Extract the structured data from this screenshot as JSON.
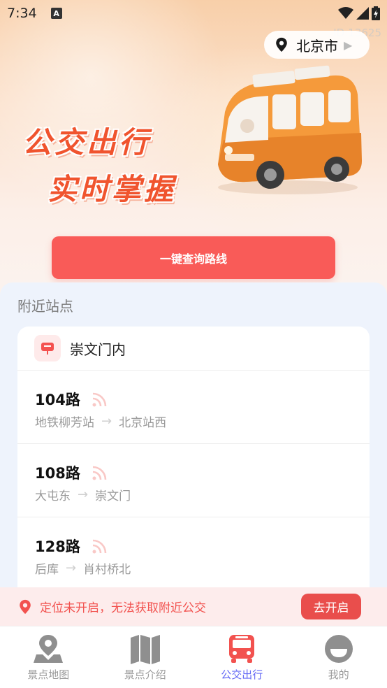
{
  "status_bar": {
    "time": "7:34",
    "notification_icon": "text-a-icon"
  },
  "watermark": "ID:13625",
  "location": {
    "city": "北京市"
  },
  "banner": {
    "line1": "公交出行",
    "line2": "实时掌握"
  },
  "query_button_label": "一键查询路线",
  "nearby": {
    "title": "附近站点",
    "stop_name": "崇文门内",
    "routes": [
      {
        "name": "104路",
        "from": "地铁柳芳站",
        "to": "北京站西"
      },
      {
        "name": "108路",
        "from": "大屯东",
        "to": "崇文门"
      },
      {
        "name": "128路",
        "from": "后库",
        "to": "肖村桥北"
      }
    ]
  },
  "location_notice": {
    "text": "定位未开启，无法获取附近公交",
    "button_label": "去开启"
  },
  "tabs": [
    {
      "label": "景点地图",
      "icon": "map-pin-icon",
      "active": false
    },
    {
      "label": "景点介绍",
      "icon": "book-icon",
      "active": false
    },
    {
      "label": "公交出行",
      "icon": "bus-icon",
      "active": true
    },
    {
      "label": "我的",
      "icon": "profile-icon",
      "active": false
    }
  ],
  "colors": {
    "accent": "#f95b58",
    "active_tab": "#6469f5",
    "notice_text": "#f2524f"
  }
}
